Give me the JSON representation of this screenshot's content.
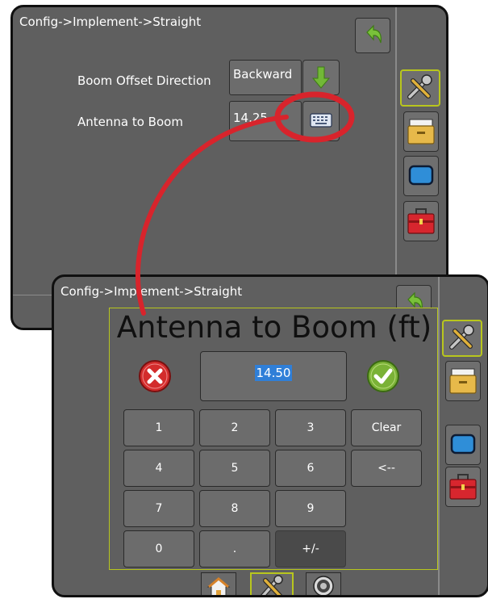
{
  "back_screen": {
    "breadcrumb": "Config->Implement->Straight",
    "rows": [
      {
        "label": "Boom Offset Direction",
        "value": "Backward"
      },
      {
        "label": "Antenna to Boom",
        "value": "14.25"
      }
    ]
  },
  "front_screen": {
    "breadcrumb": "Config->Implement->Straight",
    "keypad": {
      "title": "Antenna to Boom (ft)",
      "value": "14.50",
      "keys": [
        {
          "label": "1"
        },
        {
          "label": "2"
        },
        {
          "label": "3"
        },
        {
          "label": "Clear"
        },
        {
          "label": "4"
        },
        {
          "label": "5"
        },
        {
          "label": "6"
        },
        {
          "label": "<--"
        },
        {
          "label": "7"
        },
        {
          "label": "8"
        },
        {
          "label": "9"
        },
        {
          "label": "0"
        },
        {
          "label": "."
        },
        {
          "label": "+/-"
        }
      ]
    }
  },
  "icons": {
    "back": "back-arrow-icon",
    "tools": "tools-icon",
    "data": "data-management-icon",
    "display": "display-icon",
    "toolbox": "toolbox-icon",
    "keyboard": "keyboard-icon",
    "arrow_down": "arrow-down-icon",
    "cancel": "cancel-icon",
    "accept": "accept-icon",
    "home": "home-icon",
    "guidance": "guidance-icon"
  },
  "colors": {
    "screen_bg": "#5f5f5f",
    "selected_border": "#b8c61d",
    "accent_green": "#6fae2d",
    "cancel_red": "#d32c2c",
    "highlight_blue": "#2f7fd8",
    "callout_red": "#d8242c"
  }
}
